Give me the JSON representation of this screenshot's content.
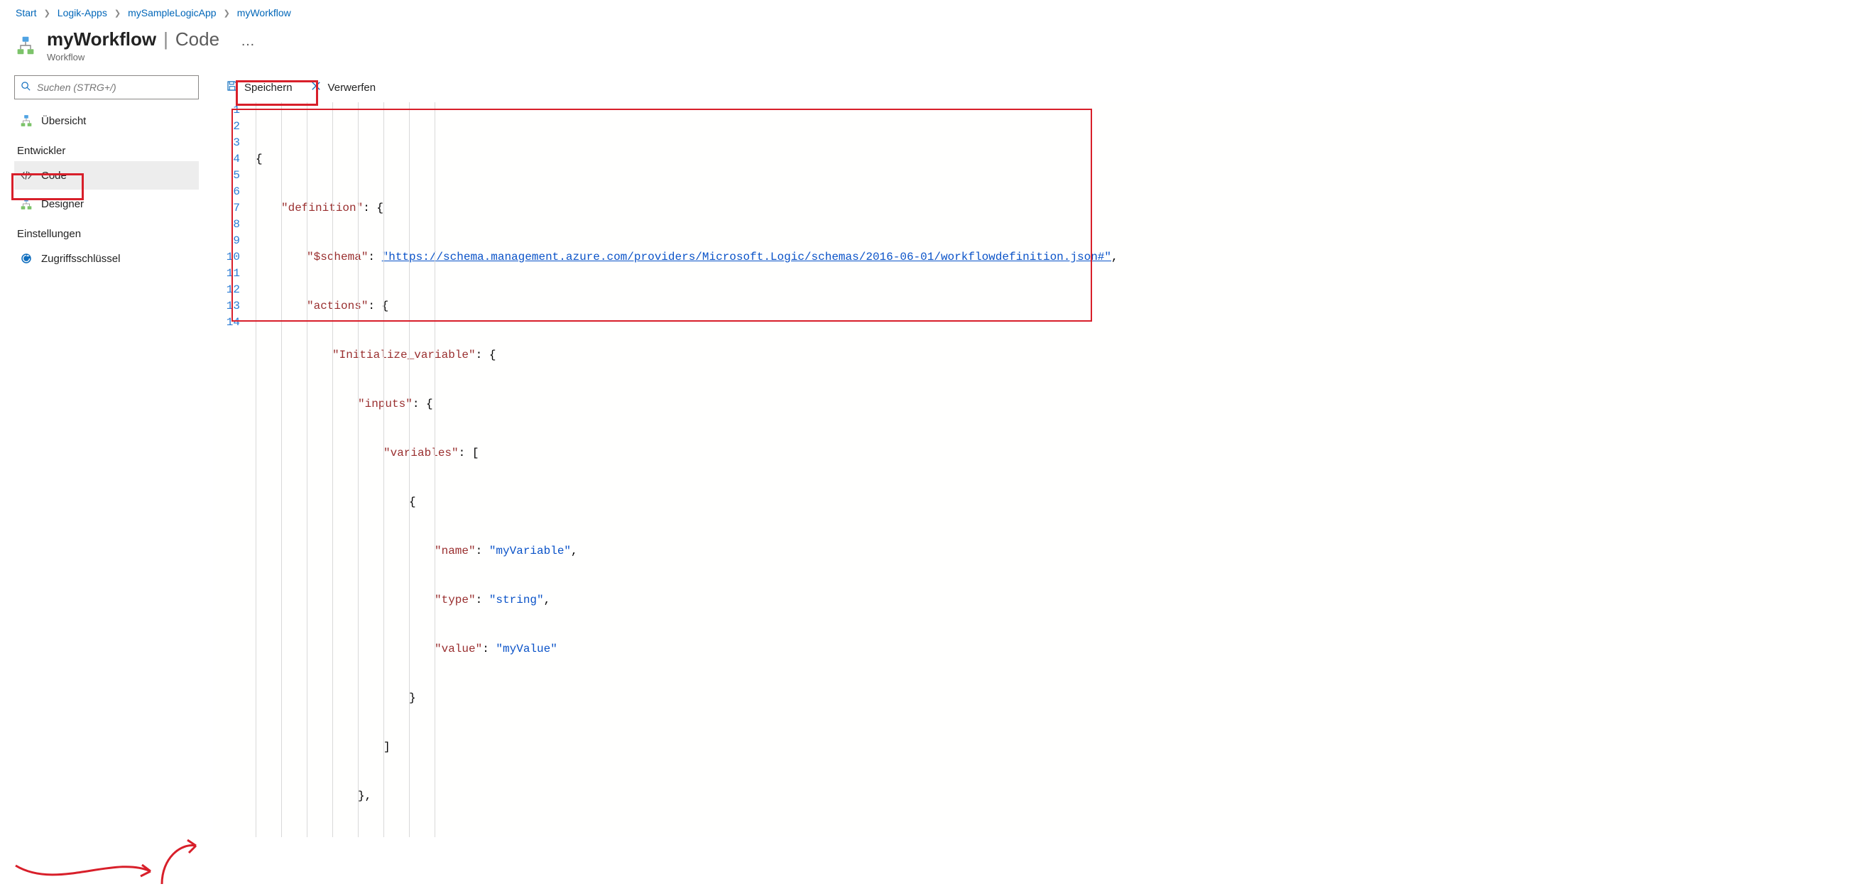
{
  "breadcrumb": {
    "items": [
      "Start",
      "Logik-Apps",
      "mySampleLogicApp",
      "myWorkflow"
    ]
  },
  "header": {
    "title": "myWorkflow",
    "section": "Code",
    "subtitle": "Workflow",
    "more": "…"
  },
  "search": {
    "placeholder": "Suchen (STRG+/)"
  },
  "nav": {
    "overview": "Übersicht",
    "section_dev": "Entwickler",
    "code": "Code",
    "designer": "Designer",
    "section_settings": "Einstellungen",
    "access_keys": "Zugriffsschlüssel"
  },
  "toolbar": {
    "save": "Speichern",
    "discard": "Verwerfen"
  },
  "editor": {
    "line_count": 14,
    "code": {
      "l1": "{",
      "l2_key": "\"definition\"",
      "l2_after": ": {",
      "l3_key": "\"$schema\"",
      "l3_after": ": ",
      "l3_val": "\"https://schema.management.azure.com/providers/Microsoft.Logic/schemas/2016-06-01/workflowdefinition.json#\"",
      "l3_end": ",",
      "l4_key": "\"actions\"",
      "l4_after": ": {",
      "l5_key": "\"Initialize_variable\"",
      "l5_after": ": {",
      "l6_key": "\"inputs\"",
      "l6_after": ": {",
      "l7_key": "\"variables\"",
      "l7_after": ": [",
      "l8": "{",
      "l9_key": "\"name\"",
      "l9_after": ": ",
      "l9_val": "\"myVariable\"",
      "l9_end": ",",
      "l10_key": "\"type\"",
      "l10_after": ": ",
      "l10_val": "\"string\"",
      "l10_end": ",",
      "l11_key": "\"value\"",
      "l11_after": ": ",
      "l11_val": "\"myValue\"",
      "l12": "}",
      "l13": "]",
      "l14": "},"
    }
  },
  "colors": {
    "highlight": "#d81f2a",
    "link": "#0066b8"
  }
}
